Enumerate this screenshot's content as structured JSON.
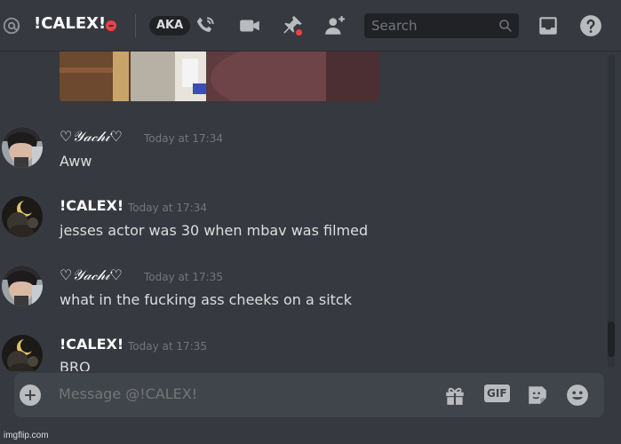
{
  "header": {
    "dm_name": "!CALEX!",
    "aka_label": "AKA",
    "search_placeholder": "Search",
    "icons": [
      "at-icon",
      "dnd-status-icon",
      "voice-call-icon",
      "video-call-icon",
      "pinned-messages-icon",
      "add-friend-icon",
      "search-icon",
      "inbox-icon",
      "help-icon"
    ]
  },
  "messages": [
    {
      "author": "♡𝒴𝒶𝒸𝒽𝒾♡",
      "timestamp": "Today at 17:34",
      "content": "Aww"
    },
    {
      "author": "!CALEX!",
      "timestamp": "Today at 17:34",
      "content": "jesses actor was 30 when mbav was filmed"
    },
    {
      "author": "♡𝒴𝒶𝒸𝒽𝒾♡",
      "timestamp": "Today at 17:35",
      "content": "what in the fucking ass cheeks on a sitck"
    },
    {
      "author": "!CALEX!",
      "timestamp": "Today at 17:35",
      "content": "BRO"
    }
  ],
  "composer": {
    "placeholder": "Message @!CALEX!",
    "gif_label": "GIF",
    "icons": [
      "add-attachment-icon",
      "gift-icon",
      "gif-icon",
      "sticker-icon",
      "emoji-icon"
    ]
  },
  "colors": {
    "background": "#36393f",
    "header_text": "#ffffff",
    "status_dnd": "#ed4245",
    "timestamp": "#72767d",
    "message_text": "#dcddde"
  },
  "watermark": "imgflip.com"
}
